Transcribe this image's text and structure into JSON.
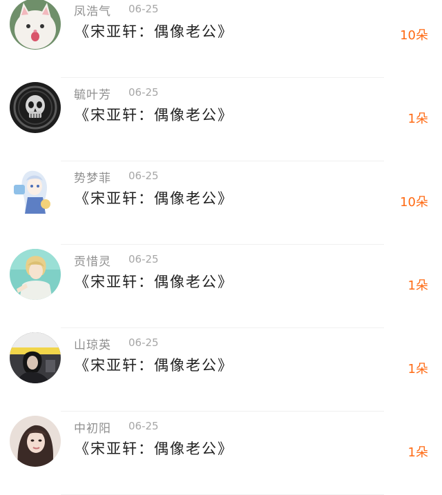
{
  "list": {
    "items": [
      {
        "name": "凤浩气",
        "date": "06-25",
        "title": "《宋亚轩：偶像老公》",
        "count": "10朵",
        "avatar_icon": "white-cat-avatar-icon"
      },
      {
        "name": "毓叶芳",
        "date": "06-25",
        "title": "《宋亚轩：偶像老公》",
        "count": "1朵",
        "avatar_icon": "skull-emblem-avatar-icon"
      },
      {
        "name": "势梦菲",
        "date": "06-25",
        "title": "《宋亚轩：偶像老公》",
        "count": "10朵",
        "avatar_icon": "anime-character-avatar-icon"
      },
      {
        "name": "贡惜灵",
        "date": "06-25",
        "title": "《宋亚轩：偶像老公》",
        "count": "1朵",
        "avatar_icon": "anime-boy-avatar-icon"
      },
      {
        "name": "山琼英",
        "date": "06-25",
        "title": "《宋亚轩：偶像老公》",
        "count": "1朵",
        "avatar_icon": "dark-photo-avatar-icon"
      },
      {
        "name": "中初阳",
        "date": "06-25",
        "title": "《宋亚轩：偶像老公》",
        "count": "1朵",
        "avatar_icon": "portrait-avatar-icon"
      }
    ]
  },
  "colors": {
    "count": "#ff6a13",
    "name": "#8f8f8f",
    "title": "#222222",
    "divider": "#f0f0f0"
  }
}
